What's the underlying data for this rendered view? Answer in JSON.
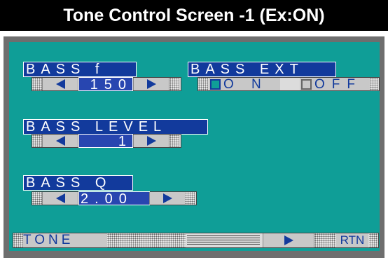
{
  "title": "Tone Control Screen -1 (Ex:ON)",
  "bass_f": {
    "label": "BASS f",
    "value": "150"
  },
  "bass_ext": {
    "label": "BASS EXT",
    "on_label": "O N",
    "off_label": "OFF"
  },
  "bass_level": {
    "label": "BASS LEVEL",
    "value": "1"
  },
  "bass_q": {
    "label": "BASS Q",
    "value": "2.00"
  },
  "bottom": {
    "tone_label": "TONE",
    "rtn_label": "RTN"
  },
  "colors": {
    "background": "#0f9e97",
    "label_bg": "#123a9c",
    "value_bg": "#2846b0"
  },
  "icons": [
    "left-arrow-icon",
    "right-arrow-icon",
    "checkbox-icon"
  ]
}
